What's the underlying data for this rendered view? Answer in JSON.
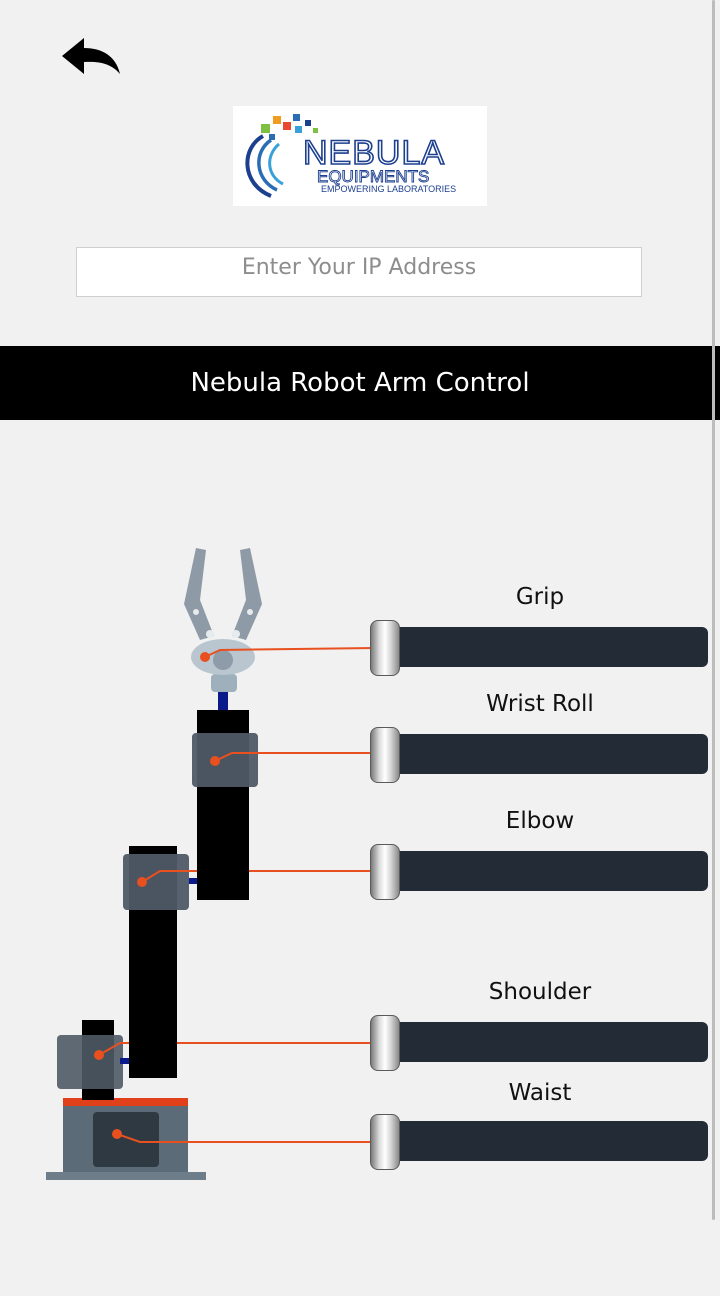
{
  "header": {
    "back_icon": "back-arrow-icon",
    "logo": {
      "brand": "NEBULA",
      "subtitle": "EQUIPMENTS",
      "tagline": "EMPOWERING LABORATORIES"
    }
  },
  "ip_input": {
    "placeholder": "Enter Your IP Address",
    "value": ""
  },
  "banner": {
    "title": "Nebula Robot Arm Control"
  },
  "sliders": [
    {
      "label": "Grip",
      "value": 0
    },
    {
      "label": "Wrist Roll",
      "value": 0
    },
    {
      "label": "Elbow",
      "value": 0
    },
    {
      "label": "Shoulder",
      "value": 0
    },
    {
      "label": "Waist",
      "value": 0
    }
  ],
  "colors": {
    "accent": "#e8501f",
    "track": "#222b36",
    "banner": "#000000",
    "arm": "#000000",
    "servo": "#4e5a66"
  }
}
